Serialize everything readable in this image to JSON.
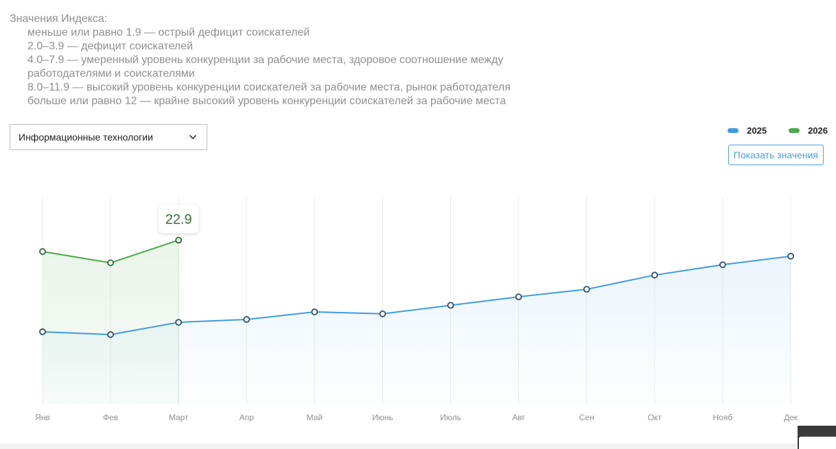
{
  "index_legend": {
    "title": "Значения Индекса:",
    "items": [
      "меньше или равно 1.9 — острый дефицит соискателей",
      "2.0–3.9 — дефицит соискателей",
      "4.0–7.9 — умеренный уровень конкуренции за рабочие места, здоровое соотношение между работодателями и соискателями",
      "8.0–11.9 — высокий уровень конкуренции соискателей за рабочие места, рынок работодателя",
      "больше или равно 12 — крайне высокий уровень конкуренции соискателей за рабочие места"
    ]
  },
  "filter": {
    "selected": "Информационные технологии"
  },
  "legend": {
    "items": [
      {
        "label": "2025",
        "color": "#3d9be0"
      },
      {
        "label": "2026",
        "color": "#4aa84a"
      }
    ]
  },
  "show_values_button": "Показать значения",
  "chart_data": {
    "type": "line",
    "categories": [
      "Янв",
      "Фев",
      "Март",
      "Апр",
      "Май",
      "Июнь",
      "Июль",
      "Авг",
      "Сен",
      "Окт",
      "Нояб",
      "Дек"
    ],
    "series": [
      {
        "name": "2025",
        "color": "#3d9be0",
        "values": [
          13.2,
          12.9,
          14.2,
          14.5,
          15.3,
          15.1,
          16.0,
          16.9,
          17.7,
          19.2,
          20.3,
          21.2
        ]
      },
      {
        "name": "2026",
        "color": "#4aa84a",
        "values": [
          21.7,
          20.5,
          22.9
        ]
      }
    ],
    "ylim": [
      5.5,
      27.5
    ],
    "grid": {
      "vertical": true,
      "horizontal": false
    },
    "yaxis_visible": false,
    "legend_position": "top-right",
    "tooltip": {
      "series": "2026",
      "category": "Март",
      "value": "22.9"
    }
  }
}
